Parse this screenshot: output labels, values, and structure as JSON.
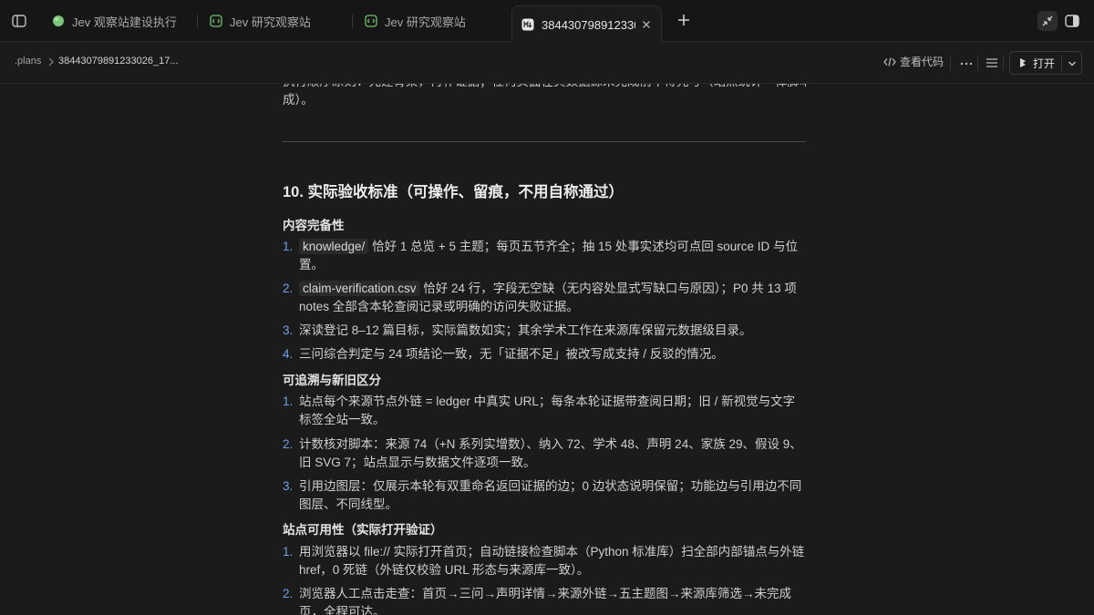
{
  "tabs": [
    {
      "label": "Jev 观察站建设执行"
    },
    {
      "label": "Jev 研究观察站"
    },
    {
      "label": "Jev 研究观察站"
    },
    {
      "label": "38443079891233026_17"
    }
  ],
  "breadcrumb": {
    "root": ".plans",
    "file": "38443079891233026_17..."
  },
  "toolbar": {
    "view_code": "查看代码",
    "open": "打开"
  },
  "colors": {
    "accent": "#6fa0e6",
    "background": "#1b1b1b",
    "tab_strip": "#161616"
  },
  "doc": {
    "cut_line_1": "执行顺序原则：先建骨架，再补证据；任何页面在其数据源未完成前不得先写（站点统计一律脚本生",
    "cut_line_2": "成）。",
    "section_title": "10. 实际验收标准（可操作、留痕，不用自称通过）",
    "sub1": {
      "title": "内容完备性",
      "items": [
        {
          "num": "1.",
          "code": "knowledge/",
          "rest": " 恰好 1 总览 + 5 主题；每页五节齐全；抽 15 处事实述均可点回 source ID 与位置。"
        },
        {
          "num": "2.",
          "code": "claim-verification.csv",
          "rest": " 恰好 24 行，字段无空缺（无内容处显式写缺口与原因）；P0 共 13 项 notes 全部含本轮查阅记录或明确的访问失败证据。"
        },
        {
          "num": "3.",
          "text": "深读登记 8–12 篇目标，实际篇数如实；其余学术工作在来源库保留元数据级目录。"
        },
        {
          "num": "4.",
          "text": "三问综合判定与 24 项结论一致，无「证据不足」被改写成支持 / 反驳的情况。"
        }
      ]
    },
    "sub2": {
      "title": "可追溯与新旧区分",
      "items": [
        {
          "num": "1.",
          "text": "站点每个来源节点外链 = ledger 中真实 URL；每条本轮证据带查阅日期；旧 / 新视觉与文字标签全站一致。"
        },
        {
          "num": "2.",
          "text": "计数核对脚本：来源 74（+N 系列实增数）、纳入 72、学术 48、声明 24、家族 29、假设 9、旧 SVG 7；站点显示与数据文件逐项一致。"
        },
        {
          "num": "3.",
          "text": "引用边图层：仅展示本轮有双重命名返回证据的边；0 边状态说明保留；功能边与引用边不同图层、不同线型。"
        }
      ]
    },
    "sub3": {
      "title": "站点可用性（实际打开验证）",
      "items": [
        {
          "num": "1.",
          "text": "用浏览器以 file:// 实际打开首页；自动链接检查脚本（Python 标准库）扫全部内部锚点与外链 href，0 死链（外链仅校验 URL 形态与来源库一致）。"
        },
        {
          "num": "2.",
          "text": "浏览器人工点击走查：首页→三问→声明详情→来源外链→五主题图→来源库筛选→未完成页，全程可达。"
        }
      ]
    }
  }
}
